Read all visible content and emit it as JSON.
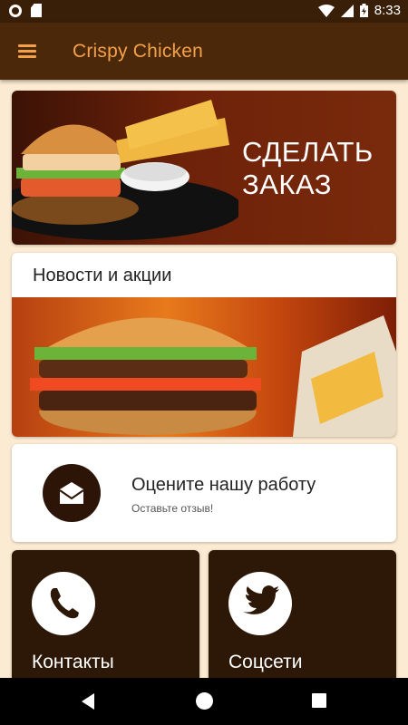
{
  "status_bar": {
    "time": "8:33"
  },
  "app_bar": {
    "title": "Crispy Chicken",
    "menu_icon": "hamburger-menu-icon"
  },
  "order_card": {
    "line1": "СДЕЛАТЬ",
    "line2": "ЗАКАЗ"
  },
  "news_card": {
    "title": "Новости и акции"
  },
  "review_card": {
    "title": "Оцените нашу работу",
    "subtitle": "Оставьте отзыв!",
    "icon": "envelope-icon"
  },
  "tiles": {
    "contacts": {
      "label": "Контакты",
      "icon": "phone-icon"
    },
    "social": {
      "label": "Соцсети",
      "icon": "twitter-bird-icon"
    }
  },
  "colors": {
    "app_bar": "#4b2809",
    "accent": "#f5a14a",
    "background": "#fcebd3",
    "tile": "#2d1807"
  }
}
